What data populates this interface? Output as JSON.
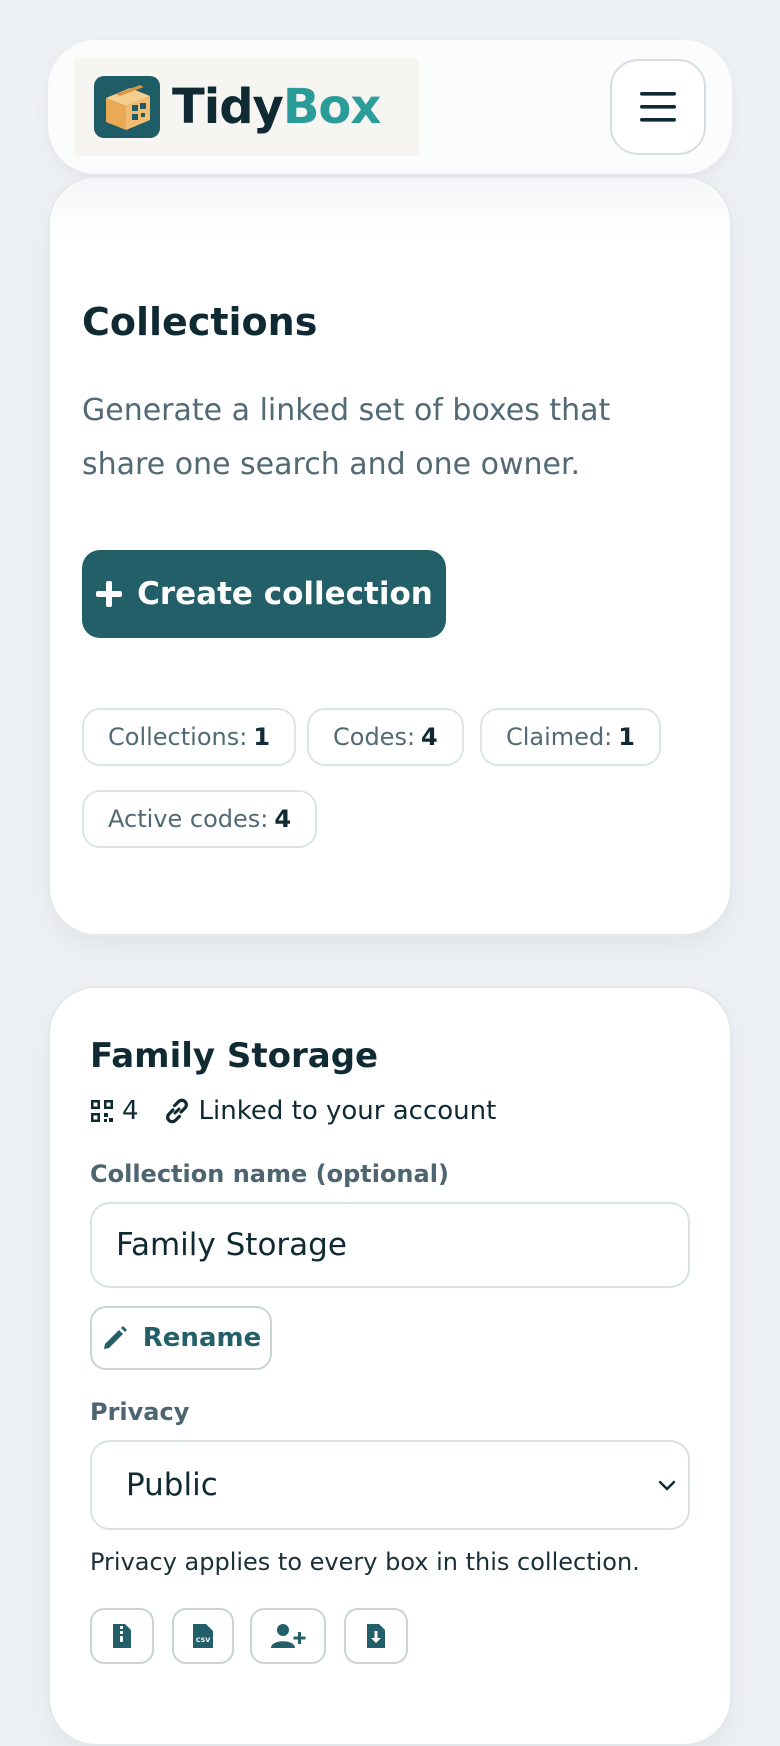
{
  "brand": {
    "name_part1": "Tidy",
    "name_part2": "Box",
    "colors": {
      "dark": "#0f2a33",
      "teal": "#2a9d9a",
      "logo_bg": "#1f5d66",
      "box": "#f0b96a"
    }
  },
  "header": {
    "menu_icon": "hamburger-menu-icon"
  },
  "hero": {
    "title": "Collections",
    "description": "Generate a linked set of boxes that share one search and one owner.",
    "create_button_label": "Create collection",
    "create_button_icon": "plus-icon",
    "accent": "#235f68",
    "stats": [
      {
        "label": "Collections:",
        "value": "1"
      },
      {
        "label": "Codes:",
        "value": "4"
      },
      {
        "label": "Claimed:",
        "value": "1"
      },
      {
        "label": "Active codes:",
        "value": "4"
      }
    ]
  },
  "collection": {
    "title": "Family Storage",
    "code_count": "4",
    "code_icon": "qr-code-icon",
    "linked_icon": "link-icon",
    "linked_text": "Linked to your account",
    "name_label": "Collection name (optional)",
    "name_value": "Family Storage",
    "rename_label": "Rename",
    "rename_icon": "pencil-icon",
    "privacy_label": "Privacy",
    "privacy_value": "Public",
    "privacy_help": "Privacy applies to every box in this collection.",
    "actions": [
      {
        "icon": "zip-file-icon"
      },
      {
        "icon": "csv-file-icon"
      },
      {
        "icon": "add-user-icon"
      },
      {
        "icon": "download-file-icon"
      }
    ]
  }
}
